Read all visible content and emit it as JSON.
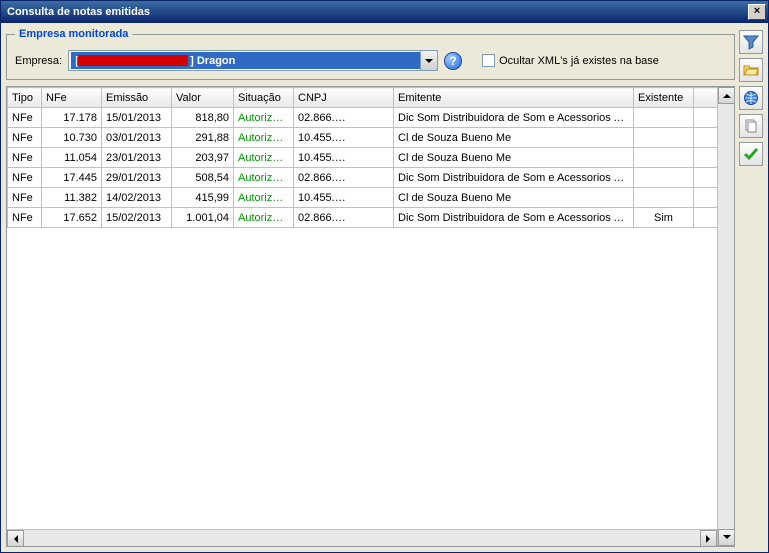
{
  "window": {
    "title": "Consulta de notas emitidas"
  },
  "group": {
    "legend": "Empresa monitorada",
    "empresa_label": "Empresa:",
    "empresa_value_prefix": "[",
    "empresa_value_suffix": "] Dragon",
    "help_glyph": "?",
    "ocultar_label": "Ocultar XML's já existes na base",
    "ocultar_checked": false
  },
  "columns": {
    "tipo": "Tipo",
    "nfe": "NFe",
    "emissao": "Emissão",
    "valor": "Valor",
    "situacao": "Situação",
    "cnpj": "CNPJ",
    "emitente": "Emitente",
    "existente": "Existente"
  },
  "rows": [
    {
      "tipo": "NFe",
      "nfe": "17.178",
      "emissao": "15/01/2013",
      "valor": "818,80",
      "situacao": "Autorizada",
      "cnpj_prefix": "02.866.",
      "emitente": "Dic Som Distribuidora de Som e Acessorios Aut...",
      "existente": ""
    },
    {
      "tipo": "NFe",
      "nfe": "10.730",
      "emissao": "03/01/2013",
      "valor": "291,88",
      "situacao": "Autorizada",
      "cnpj_prefix": "10.455.",
      "emitente": "Cl de Souza Bueno Me",
      "existente": ""
    },
    {
      "tipo": "NFe",
      "nfe": "11.054",
      "emissao": "23/01/2013",
      "valor": "203,97",
      "situacao": "Autorizada",
      "cnpj_prefix": "10.455.",
      "emitente": "Cl de Souza Bueno Me",
      "existente": ""
    },
    {
      "tipo": "NFe",
      "nfe": "17.445",
      "emissao": "29/01/2013",
      "valor": "508,54",
      "situacao": "Autorizada",
      "cnpj_prefix": "02.866.",
      "emitente": "Dic Som Distribuidora de Som e Acessorios Aut...",
      "existente": ""
    },
    {
      "tipo": "NFe",
      "nfe": "11.382",
      "emissao": "14/02/2013",
      "valor": "415,99",
      "situacao": "Autorizada",
      "cnpj_prefix": "10.455.",
      "emitente": "Cl de Souza Bueno Me",
      "existente": ""
    },
    {
      "tipo": "NFe",
      "nfe": "17.652",
      "emissao": "15/02/2013",
      "valor": "1.001,04",
      "situacao": "Autorizada",
      "cnpj_prefix": "02.866.",
      "emitente": "Dic Som Distribuidora de Som e Acessorios Aut...",
      "existente": "Sim"
    }
  ],
  "toolbar": {
    "filter": "filter",
    "open_folder": "open-folder",
    "globe": "globe",
    "copy": "copy",
    "confirm": "confirm"
  }
}
